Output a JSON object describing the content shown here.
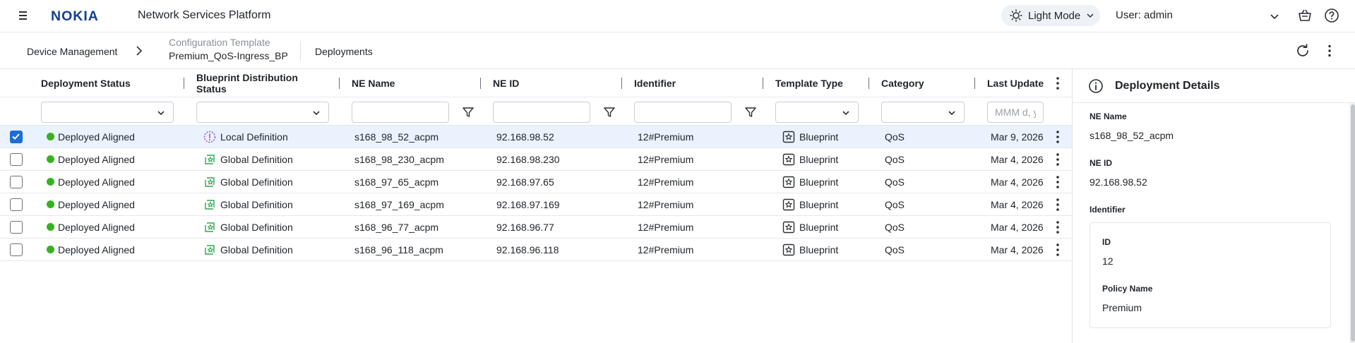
{
  "header": {
    "brand": "NOKIA",
    "app_title": "Network Services Platform",
    "theme_label": "Light Mode",
    "user_label": "User: admin"
  },
  "breadcrumb": {
    "device_management": "Device Management",
    "config_template_label": "Configuration Template",
    "config_template_name": "Premium_QoS-Ingress_BP",
    "deployments": "Deployments"
  },
  "table": {
    "columns": {
      "deployment_status": "Deployment Status",
      "blueprint_status": "Blueprint Distribution Status",
      "ne_name": "NE Name",
      "ne_id": "NE ID",
      "identifier": "Identifier",
      "template_type": "Template Type",
      "category": "Category",
      "last_update": "Last Update"
    },
    "filters": {
      "last_update_placeholder": "MMM d, yy"
    },
    "rows": [
      {
        "checked": true,
        "status": "Deployed Aligned",
        "bp_status": "Local Definition",
        "ne_name": "s168_98_52_acpm",
        "ne_id": "92.168.98.52",
        "identifier": "12#Premium",
        "template_type": "Blueprint",
        "category": "QoS",
        "last_update": "Mar 9, 2026"
      },
      {
        "checked": false,
        "status": "Deployed Aligned",
        "bp_status": "Global Definition",
        "ne_name": "s168_98_230_acpm",
        "ne_id": "92.168.98.230",
        "identifier": "12#Premium",
        "template_type": "Blueprint",
        "category": "QoS",
        "last_update": "Mar 4, 2026"
      },
      {
        "checked": false,
        "status": "Deployed Aligned",
        "bp_status": "Global Definition",
        "ne_name": "s168_97_65_acpm",
        "ne_id": "92.168.97.65",
        "identifier": "12#Premium",
        "template_type": "Blueprint",
        "category": "QoS",
        "last_update": "Mar 4, 2026"
      },
      {
        "checked": false,
        "status": "Deployed Aligned",
        "bp_status": "Global Definition",
        "ne_name": "s168_97_169_acpm",
        "ne_id": "92.168.97.169",
        "identifier": "12#Premium",
        "template_type": "Blueprint",
        "category": "QoS",
        "last_update": "Mar 4, 2026"
      },
      {
        "checked": false,
        "status": "Deployed Aligned",
        "bp_status": "Global Definition",
        "ne_name": "s168_96_77_acpm",
        "ne_id": "92.168.96.77",
        "identifier": "12#Premium",
        "template_type": "Blueprint",
        "category": "QoS",
        "last_update": "Mar 4, 2026"
      },
      {
        "checked": false,
        "status": "Deployed Aligned",
        "bp_status": "Global Definition",
        "ne_name": "s168_96_118_acpm",
        "ne_id": "92.168.96.118",
        "identifier": "12#Premium",
        "template_type": "Blueprint",
        "category": "QoS",
        "last_update": "Mar 4, 2026"
      }
    ]
  },
  "details": {
    "title": "Deployment Details",
    "ne_name_label": "NE Name",
    "ne_name_value": "s168_98_52_acpm",
    "ne_id_label": "NE ID",
    "ne_id_value": "92.168.98.52",
    "identifier_label": "Identifier",
    "id_label": "ID",
    "id_value": "12",
    "policy_name_label": "Policy Name",
    "policy_name_value": "Premium"
  },
  "colors": {
    "brand_blue": "#124191",
    "accent_blue": "#1a6ed8",
    "status_green": "#36b21f",
    "local_purple": "#9b4fd1",
    "global_green": "#2fa84f",
    "selected_row": "#eaf2fd"
  },
  "icons": {
    "menu": "hamburger-icon",
    "theme": "sun-icon",
    "cart": "basket-icon",
    "help": "help-icon",
    "refresh": "refresh-icon",
    "more": "more-vertical-icon",
    "filter": "funnel-icon",
    "local": "local-definition-icon",
    "global": "global-definition-icon",
    "blueprint": "blueprint-star-icon",
    "info": "info-icon"
  }
}
